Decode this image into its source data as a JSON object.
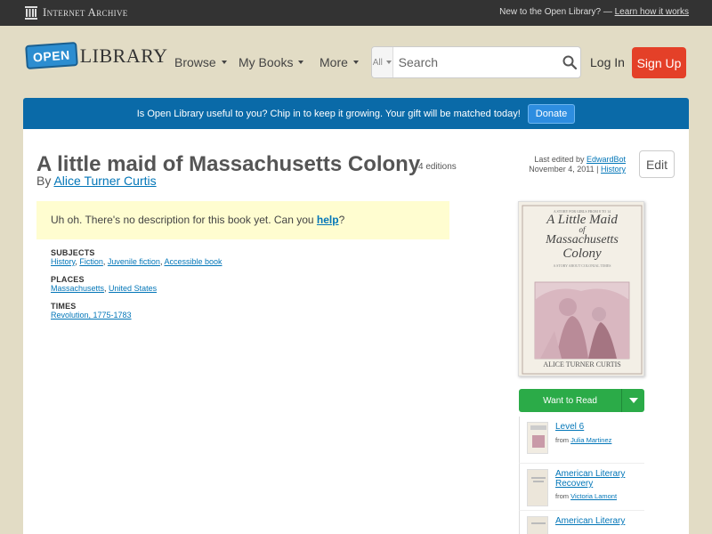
{
  "ia_bar": {
    "logo_text": "Internet Archive",
    "note_text": "New to the Open Library? —",
    "note_link": "Learn how it works"
  },
  "header": {
    "logo_open": "OPEN",
    "logo_library": "LIBRARY",
    "nav": [
      "Browse",
      "My Books",
      "More"
    ],
    "search_scope": "All",
    "search_placeholder": "Search",
    "login": "Log In",
    "signup": "Sign Up"
  },
  "banner": {
    "text": "Is Open Library useful to you? Chip in to keep it growing. Your gift will be matched today!",
    "button": "Donate"
  },
  "book": {
    "title": "A little maid of Massachusetts Colony",
    "editions": "4 editions",
    "by": "By",
    "author": "Alice Turner Curtis",
    "last_edited_label": "Last edited by",
    "last_edited_user": "EdwardBot",
    "last_edited_date": "November 4, 2011",
    "history_link": "History",
    "edit_button": "Edit",
    "no_description_prefix": "Uh oh. There's no description for this book yet. Can you",
    "help_link": "help",
    "no_description_suffix": "?"
  },
  "facets": {
    "subjects_label": "SUBJECTS",
    "subjects": [
      "History",
      "Fiction",
      "Juvenile fiction",
      "Accessible book"
    ],
    "places_label": "PLACES",
    "places": [
      "Massachusetts",
      "United States"
    ],
    "times_label": "TIMES",
    "times": [
      "Revolution, 1775-1783"
    ]
  },
  "cover": {
    "top_line": "A STORY FOR GIRLS FROM 8 TO 14",
    "title_line1": "A Little Maid",
    "title_line2": "of",
    "title_line3": "Massachusetts",
    "title_line4": "Colony",
    "subtitle": "A STORY ABOUT COLONIAL TIMES",
    "author": "ALICE TURNER CURTIS"
  },
  "want_to_read": "Want to Read",
  "lists": [
    {
      "title": "Level 6",
      "from_label": "from",
      "from_user": "Julia Martinez"
    },
    {
      "title": "American Literary Recovery",
      "from_label": "from",
      "from_user": "Victoria Lamont"
    },
    {
      "title": "American Literary",
      "from_label": "",
      "from_user": ""
    }
  ],
  "colors": {
    "ia_bar": "#333333",
    "page_bg": "#e2dcc5",
    "banner": "#0a6aa8",
    "signup": "#e44028",
    "want_to_read": "#2bab48",
    "link": "#0376b8"
  }
}
